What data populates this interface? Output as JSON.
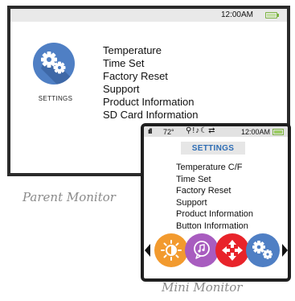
{
  "parent_monitor": {
    "status_time": "12:00AM",
    "icon_label": "SETTINGS",
    "menu_items": [
      "Temperature",
      "Time Set",
      "Factory Reset",
      "Support",
      "Product Information",
      "SD Card Information"
    ],
    "icon_color": "#4f7fc4"
  },
  "mini_monitor": {
    "status": {
      "signal": "ıll",
      "temperature": "72°",
      "icons": "⚲!♪☾⇄",
      "time": "12:00AM"
    },
    "title": "SETTINGS",
    "menu_items": [
      "Temperature C/F",
      "Time Set",
      "Factory Reset",
      "Support",
      "Product Information",
      "Button Information"
    ],
    "carousel": [
      {
        "name": "brightness-icon",
        "color": "#f29a2e"
      },
      {
        "name": "lullaby-icon",
        "color": "#a85cbf"
      },
      {
        "name": "pan-tilt-icon",
        "color": "#e8232a"
      },
      {
        "name": "settings-icon",
        "color": "#4f7fc4"
      }
    ]
  },
  "captions": {
    "parent": "Parent Monitor",
    "mini": "Mini Monitor"
  }
}
